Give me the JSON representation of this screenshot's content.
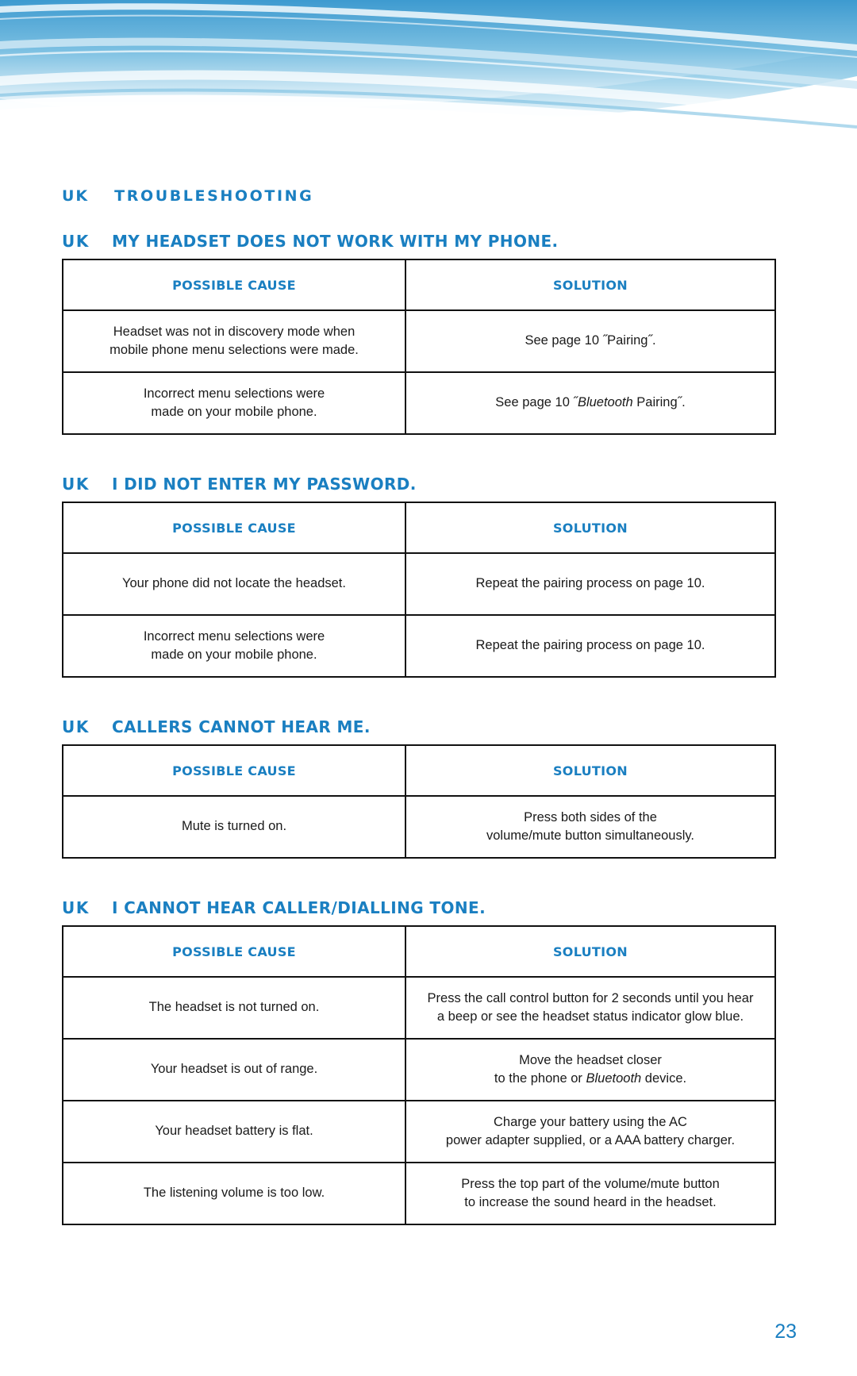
{
  "page": {
    "number": "23",
    "locale_tag": "UK",
    "main_heading": "TROUBLESHOOTING"
  },
  "table_headers": {
    "cause": "POSSIBLE CAUSE",
    "solution": "SOLUTION"
  },
  "colors": {
    "accent_blue": "#1a7fc1",
    "banner_blue": "#4da3d4",
    "border_black": "#111111",
    "text_black": "#1a1a1a"
  },
  "sections": [
    {
      "tag": "UK",
      "title": "MY HEADSET DOES NOT WORK WITH MY PHONE.",
      "rows": [
        {
          "cause": "Headset was not in discovery mode when\nmobile phone menu selections were made.",
          "solution": "See page 10 ˝Pairing˝."
        },
        {
          "cause": "Incorrect menu selections were\nmade on your mobile phone.",
          "solution_pre": "See page 10 ˝Bluetooth Pairing˝.",
          "solution_parts": [
            "See page 10 ˝",
            "Bluetooth",
            " Pairing˝."
          ]
        }
      ]
    },
    {
      "tag": "UK",
      "title": "I DID NOT ENTER MY PASSWORD.",
      "rows": [
        {
          "cause": "Your phone did not locate the headset.",
          "solution": "Repeat the pairing process on page 10."
        },
        {
          "cause": "Incorrect menu selections were\nmade on your mobile phone.",
          "solution": "Repeat the pairing process on page 10."
        }
      ]
    },
    {
      "tag": "UK",
      "title": "CALLERS CANNOT HEAR ME.",
      "rows": [
        {
          "cause": "Mute is turned on.",
          "solution": "Press both sides of the\nvolume/mute button simultaneously."
        }
      ]
    },
    {
      "tag": "UK",
      "title": "I CANNOT HEAR CALLER/DIALLING TONE.",
      "rows": [
        {
          "cause": "The headset is not turned on.",
          "solution": "Press the call control button for 2 seconds until you hear\na beep or see the headset status indicator glow blue."
        },
        {
          "cause": "Your headset is out of range.",
          "solution_parts": [
            "Move the headset closer\nto the phone or ",
            "Bluetooth",
            " device."
          ]
        },
        {
          "cause": "Your headset battery is flat.",
          "solution": "Charge your battery using the AC\npower adapter supplied, or a AAA battery charger."
        },
        {
          "cause": "The listening volume is too low.",
          "solution": "Press the top part of the volume/mute button\nto increase the sound heard in the headset."
        }
      ]
    }
  ]
}
